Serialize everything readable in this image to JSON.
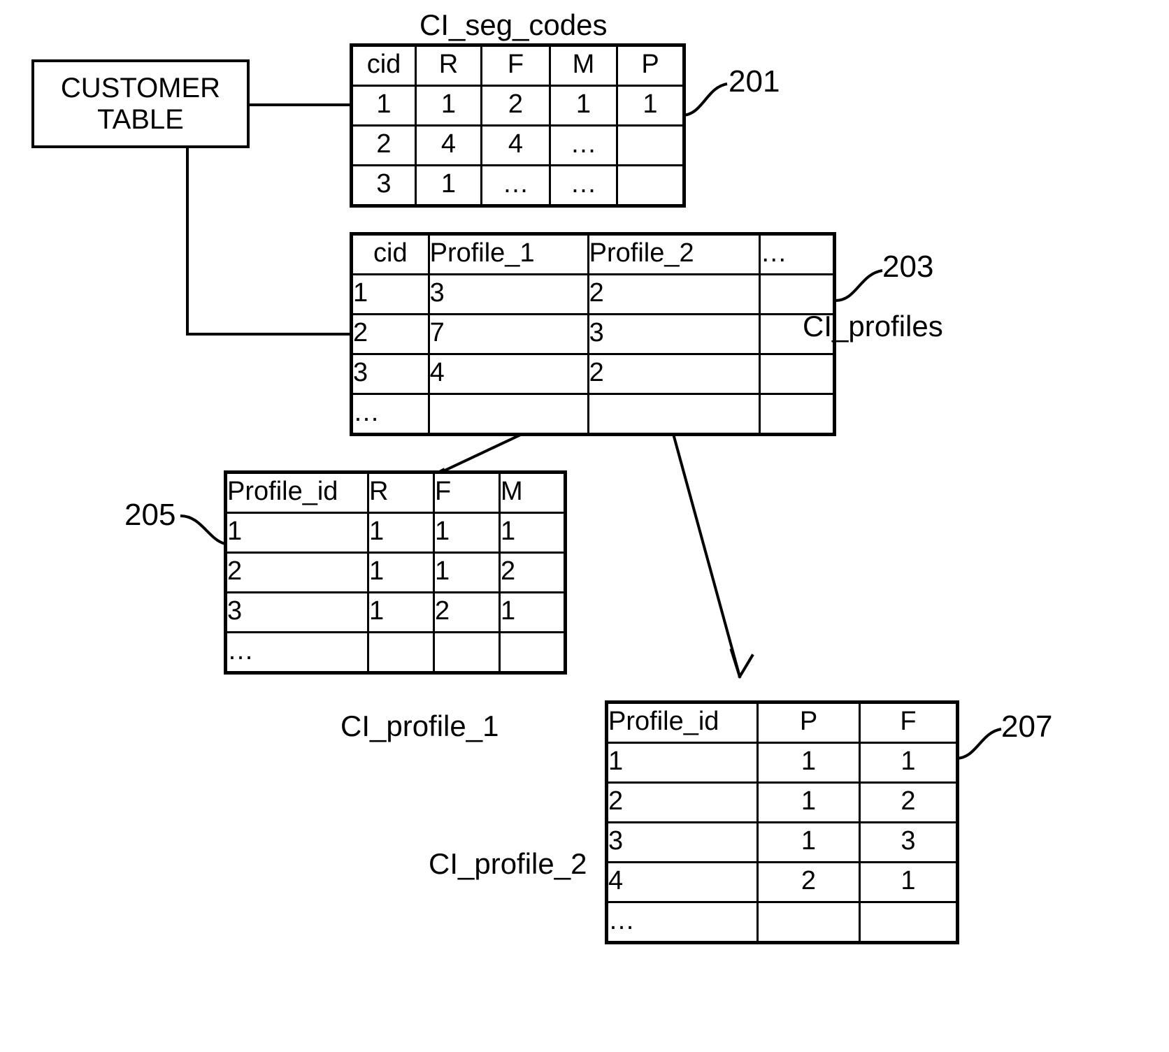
{
  "figure": {
    "title_label": "CI_seg_codes",
    "kind": "patent-data-model-diagram"
  },
  "process_box": {
    "name": "customer-table-box",
    "line1": "CUSTOMER",
    "line2": "TABLE"
  },
  "tables": [
    {
      "id": "t201",
      "ref": "201",
      "title_above": "CI_seg_codes",
      "title_side": "",
      "columns": [
        "cid",
        "R",
        "F",
        "M",
        "P"
      ],
      "rows": [
        [
          "1",
          "1",
          "2",
          "1",
          "1"
        ],
        [
          "2",
          "4",
          "4",
          "…",
          ""
        ],
        [
          "3",
          "1",
          "…",
          "…",
          ""
        ]
      ]
    },
    {
      "id": "t203",
      "ref": "203",
      "title_above": "",
      "title_side": "CI_profiles",
      "columns": [
        "cid",
        "Profile_1",
        "Profile_2",
        "…"
      ],
      "rows": [
        [
          "1",
          "3",
          "2",
          ""
        ],
        [
          "2",
          "7",
          "3",
          ""
        ],
        [
          "3",
          "4",
          "2",
          ""
        ],
        [
          "…",
          "",
          "",
          ""
        ]
      ]
    },
    {
      "id": "t205",
      "ref": "205",
      "title_below": "CI_profile_1",
      "columns": [
        "Profile_id",
        "R",
        "F",
        "M"
      ],
      "rows": [
        [
          "1",
          "1",
          "1",
          "1"
        ],
        [
          "2",
          "1",
          "1",
          "2"
        ],
        [
          "3",
          "1",
          "2",
          "1"
        ],
        [
          "…",
          "",
          "",
          ""
        ]
      ]
    },
    {
      "id": "t207",
      "ref": "207",
      "title_side": "CI_profile_2",
      "columns": [
        "Profile_id",
        "P",
        "F"
      ],
      "rows": [
        [
          "1",
          "1",
          "1"
        ],
        [
          "2",
          "1",
          "2"
        ],
        [
          "3",
          "1",
          "3"
        ],
        [
          "4",
          "2",
          "1"
        ],
        [
          "…",
          "",
          ""
        ]
      ]
    }
  ],
  "ref_numbers": {
    "n201": "201",
    "n203": "203",
    "n205": "205",
    "n207": "207"
  },
  "captions": {
    "ci_seg_codes": "CI_seg_codes",
    "ci_profiles": "CI_profiles",
    "ci_profile_1": "CI_profile_1",
    "ci_profile_2": "CI_profile_2"
  },
  "colors": {
    "ink": "#000000",
    "paper": "#ffffff"
  }
}
